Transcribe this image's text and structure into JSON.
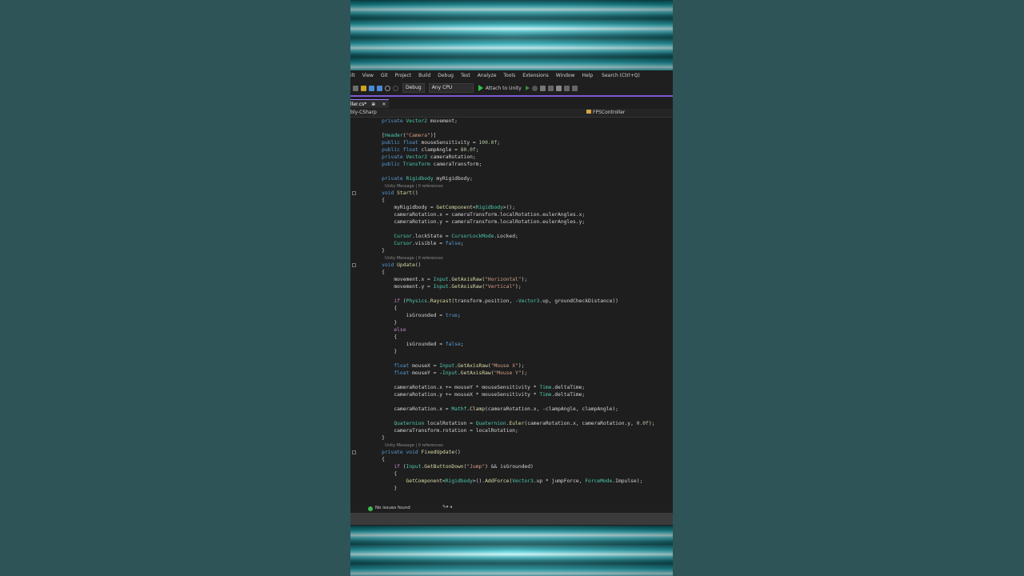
{
  "menu": [
    "ilt",
    "View",
    "Git",
    "Project",
    "Build",
    "Debug",
    "Test",
    "Analyze",
    "Tools",
    "Extensions",
    "Window",
    "Help"
  ],
  "search_label": "Search (Ctrl+Q)",
  "toolbar": {
    "config": "Debug",
    "platform": "Any CPU",
    "attach_label": "Attach to Unity"
  },
  "tab": {
    "label": "ller.cs*",
    "pin": "⊕",
    "close": "✕"
  },
  "nav": {
    "left": "bly-CSharp",
    "right": "FPSController"
  },
  "code": [
    {
      "h": "    <span class=\"k\">private</span> <span class=\"t\">Vector2</span> movement;"
    },
    {
      "h": ""
    },
    {
      "h": "    [<span class=\"t\">Header</span>(<span class=\"s\">\"Camera\"</span>)]"
    },
    {
      "h": "    <span class=\"k\">public</span> <span class=\"k\">float</span> mouseSensitivity = <span class=\"n\">100.0f</span>;"
    },
    {
      "h": "    <span class=\"k\">public</span> <span class=\"k\">float</span> clampAngle = <span class=\"n\">80.0f</span>;"
    },
    {
      "h": "    <span class=\"k\">private</span> <span class=\"t\">Vector2</span> cameraRotation;"
    },
    {
      "h": "    <span class=\"k\">public</span> <span class=\"t\">Transform</span> cameraTransform;"
    },
    {
      "h": ""
    },
    {
      "h": "    <span class=\"k\">private</span> <span class=\"t\">Rigidbody</span> myRigidbody;"
    }
  ],
  "code2": [
    {
      "h": "    <span class=\"k\">void</span> <span class=\"f\">Start</span>()"
    },
    {
      "h": "    {"
    },
    {
      "h": "        myRigidbody = <span class=\"f\">GetComponent</span>&lt;<span class=\"t\">Rigidbody</span>&gt;();"
    },
    {
      "h": "        cameraRotation.x = cameraTransform.localRotation.eulerAngles.x;"
    },
    {
      "h": "        cameraRotation.y = cameraTransform.localRotation.eulerAngles.y;"
    },
    {
      "h": ""
    },
    {
      "h": "        <span class=\"t\">Cursor</span>.lockState = <span class=\"t\">CursorLockMode</span>.Locked;"
    },
    {
      "h": "        <span class=\"t\">Cursor</span>.visible = <span class=\"k\">false</span>;"
    },
    {
      "h": "    }"
    }
  ],
  "code3": [
    {
      "h": "    <span class=\"k\">void</span> <span class=\"f\">Update</span>()"
    },
    {
      "h": "    {"
    },
    {
      "h": "        movement.x = <span class=\"t\">Input</span>.<span class=\"f\">GetAxisRaw</span>(<span class=\"s\">\"Horizontal\"</span>);"
    },
    {
      "h": "        movement.y = <span class=\"t\">Input</span>.<span class=\"f\">GetAxisRaw</span>(<span class=\"s\">\"Vertical\"</span>);"
    },
    {
      "h": ""
    },
    {
      "h": "        <span class=\"c\">if</span> (<span class=\"t\">Physics</span>.<span class=\"f\">Raycast</span>(transform.position, -<span class=\"t\">Vector3</span>.up, groundCheckDistance))"
    },
    {
      "h": "        {"
    },
    {
      "h": "            isGrounded = <span class=\"k\">true</span>;"
    },
    {
      "h": "        }"
    },
    {
      "h": "        <span class=\"c\">else</span>"
    },
    {
      "h": "        {"
    },
    {
      "h": "            isGrounded = <span class=\"k\">false</span>;"
    },
    {
      "h": "        }"
    },
    {
      "h": ""
    },
    {
      "h": "        <span class=\"k\">float</span> mouseX = <span class=\"t\">Input</span>.<span class=\"f\">GetAxisRaw</span>(<span class=\"s\">\"Mouse X\"</span>);"
    },
    {
      "h": "        <span class=\"k\">float</span> mouseY = -<span class=\"t\">Input</span>.<span class=\"f\">GetAxisRaw</span>(<span class=\"s\">\"Mouse Y\"</span>);"
    },
    {
      "h": ""
    },
    {
      "h": "        cameraRotation.x += mouseY * mouseSensitivity * <span class=\"t\">Time</span>.deltaTime;"
    },
    {
      "h": "        cameraRotation.y += mouseX * mouseSensitivity * <span class=\"t\">Time</span>.deltaTime;"
    },
    {
      "h": ""
    },
    {
      "h": "        cameraRotation.x = <span class=\"t\">Mathf</span>.<span class=\"f\">Clamp</span>(cameraRotation.x, -clampAngle, clampAngle);"
    },
    {
      "h": ""
    },
    {
      "h": "        <span class=\"t\">Quaternion</span> localRotation = <span class=\"t\">Quaternion</span>.<span class=\"f\">Euler</span>(cameraRotation.x, cameraRotation.y, <span class=\"n\">0.0f</span>);"
    },
    {
      "h": "        cameraTransform.rotation = localRotation;"
    },
    {
      "h": "    }"
    }
  ],
  "code4": [
    {
      "h": "    <span class=\"k\">private</span> <span class=\"k\">void</span> <span class=\"f\">FixedUpdate</span>()"
    },
    {
      "h": "    {"
    },
    {
      "h": "        <span class=\"c\">if</span> (<span class=\"t\">Input</span>.<span class=\"f\">GetButtonDown</span>(<span class=\"s\">\"Jump\"</span>) &amp;&amp; isGrounded)"
    },
    {
      "h": "        {"
    },
    {
      "h": "            <span class=\"f\">GetComponent</span>&lt;<span class=\"t\">Rigidbody</span>&gt;().<span class=\"f\">AddForce</span>(<span class=\"t\">Vector3</span>.up * jumpForce, <span class=\"t\">ForceMode</span>.Impulse);"
    },
    {
      "h": "        }"
    }
  ],
  "codelens": "Unity Message | 0 references",
  "status": {
    "text": "No issues found"
  }
}
